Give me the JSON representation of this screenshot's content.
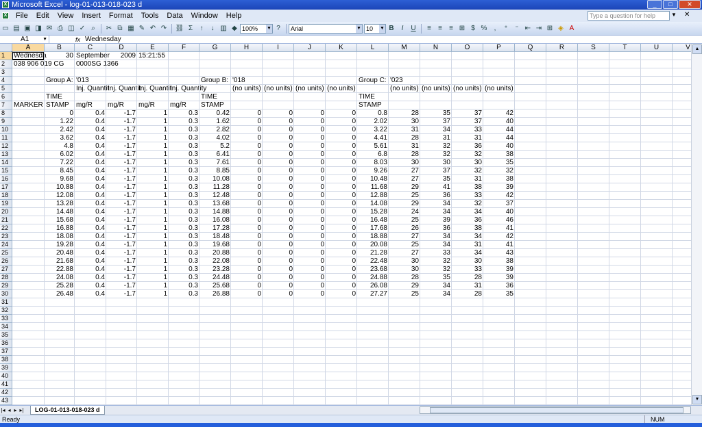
{
  "window": {
    "title": "Microsoft Excel - log-01-013-018-023 d"
  },
  "menu": [
    "File",
    "Edit",
    "View",
    "Insert",
    "Format",
    "Tools",
    "Data",
    "Window",
    "Help"
  ],
  "help_placeholder": "Type a question for help",
  "toolbar": {
    "zoom": "100%",
    "font": "Arial",
    "size": "10",
    "bold": "B",
    "italic": "I",
    "underline": "U",
    "currency": "%"
  },
  "formula": {
    "cell_ref": "A1",
    "fx": "fx",
    "content": "Wednesday"
  },
  "columns": [
    "A",
    "B",
    "C",
    "D",
    "E",
    "F",
    "G",
    "H",
    "I",
    "J",
    "K",
    "L",
    "M",
    "N",
    "O",
    "P",
    "Q",
    "R",
    "S",
    "T",
    "U",
    "V"
  ],
  "rows": [
    "1",
    "2",
    "3",
    "4",
    "5",
    "6",
    "7",
    "8",
    "9",
    "10",
    "11",
    "12",
    "13",
    "14",
    "15",
    "16",
    "17",
    "18",
    "19",
    "20",
    "21",
    "22",
    "23",
    "24",
    "25",
    "26",
    "27",
    "28",
    "29",
    "30",
    "31",
    "32",
    "33",
    "34",
    "35",
    "36",
    "37",
    "38",
    "39",
    "40",
    "41",
    "42",
    "43"
  ],
  "header_cells": {
    "a1": "Wednesda",
    "b1": "30",
    "c1": "September",
    "d1": "2009",
    "e1": "15:21:55",
    "a2": "038 906 019 CG",
    "c2": "0000SG  1366",
    "b4": "Group A:",
    "c4": "'013",
    "g4": "Group B:",
    "h4": "'018",
    "l4": "Group C:",
    "m4": "'023",
    "c5": "Inj. Quantit",
    "d5": "Inj. Quantit",
    "e5": "Inj. Quantit",
    "f5": "Inj. Quantity",
    "h5": "(no units)",
    "i5": "(no units)",
    "j5": "(no units)",
    "k5": "(no units)",
    "m5": "(no units)",
    "n5": "(no units)",
    "o5": "(no units)",
    "p5": "(no units)",
    "b6": "TIME",
    "g6": "TIME",
    "l6": "TIME",
    "a7": "MARKER",
    "b7": "STAMP",
    "c7": "mg/R",
    "d7": "mg/R",
    "e7": "mg/R",
    "f7": "mg/R",
    "g7": "STAMP",
    "l7": "STAMP"
  },
  "data_rows": [
    [
      "0",
      "0.4",
      "-1.7",
      "1",
      "0.3",
      "0.42",
      "0",
      "0",
      "0",
      "0",
      "0.8",
      "28",
      "35",
      "37",
      "42"
    ],
    [
      "1.22",
      "0.4",
      "-1.7",
      "1",
      "0.3",
      "1.62",
      "0",
      "0",
      "0",
      "0",
      "2.02",
      "30",
      "37",
      "37",
      "40"
    ],
    [
      "2.42",
      "0.4",
      "-1.7",
      "1",
      "0.3",
      "2.82",
      "0",
      "0",
      "0",
      "0",
      "3.22",
      "31",
      "34",
      "33",
      "44"
    ],
    [
      "3.62",
      "0.4",
      "-1.7",
      "1",
      "0.3",
      "4.02",
      "0",
      "0",
      "0",
      "0",
      "4.41",
      "28",
      "31",
      "31",
      "44"
    ],
    [
      "4.8",
      "0.4",
      "-1.7",
      "1",
      "0.3",
      "5.2",
      "0",
      "0",
      "0",
      "0",
      "5.61",
      "31",
      "32",
      "36",
      "40"
    ],
    [
      "6.02",
      "0.4",
      "-1.7",
      "1",
      "0.3",
      "6.41",
      "0",
      "0",
      "0",
      "0",
      "6.8",
      "28",
      "32",
      "32",
      "38"
    ],
    [
      "7.22",
      "0.4",
      "-1.7",
      "1",
      "0.3",
      "7.61",
      "0",
      "0",
      "0",
      "0",
      "8.03",
      "30",
      "30",
      "30",
      "35"
    ],
    [
      "8.45",
      "0.4",
      "-1.7",
      "1",
      "0.3",
      "8.85",
      "0",
      "0",
      "0",
      "0",
      "9.26",
      "27",
      "37",
      "32",
      "32"
    ],
    [
      "9.68",
      "0.4",
      "-1.7",
      "1",
      "0.3",
      "10.08",
      "0",
      "0",
      "0",
      "0",
      "10.48",
      "27",
      "35",
      "31",
      "38"
    ],
    [
      "10.88",
      "0.4",
      "-1.7",
      "1",
      "0.3",
      "11.28",
      "0",
      "0",
      "0",
      "0",
      "11.68",
      "29",
      "41",
      "38",
      "39"
    ],
    [
      "12.08",
      "0.4",
      "-1.7",
      "1",
      "0.3",
      "12.48",
      "0",
      "0",
      "0",
      "0",
      "12.88",
      "25",
      "36",
      "33",
      "42"
    ],
    [
      "13.28",
      "0.4",
      "-1.7",
      "1",
      "0.3",
      "13.68",
      "0",
      "0",
      "0",
      "0",
      "14.08",
      "29",
      "34",
      "32",
      "37"
    ],
    [
      "14.48",
      "0.4",
      "-1.7",
      "1",
      "0.3",
      "14.88",
      "0",
      "0",
      "0",
      "0",
      "15.28",
      "24",
      "34",
      "34",
      "40"
    ],
    [
      "15.68",
      "0.4",
      "-1.7",
      "1",
      "0.3",
      "16.08",
      "0",
      "0",
      "0",
      "0",
      "16.48",
      "25",
      "39",
      "36",
      "46"
    ],
    [
      "16.88",
      "0.4",
      "-1.7",
      "1",
      "0.3",
      "17.28",
      "0",
      "0",
      "0",
      "0",
      "17.68",
      "26",
      "36",
      "38",
      "41"
    ],
    [
      "18.08",
      "0.4",
      "-1.7",
      "1",
      "0.3",
      "18.48",
      "0",
      "0",
      "0",
      "0",
      "18.88",
      "27",
      "34",
      "34",
      "42"
    ],
    [
      "19.28",
      "0.4",
      "-1.7",
      "1",
      "0.3",
      "19.68",
      "0",
      "0",
      "0",
      "0",
      "20.08",
      "25",
      "34",
      "31",
      "41"
    ],
    [
      "20.48",
      "0.4",
      "-1.7",
      "1",
      "0.3",
      "20.88",
      "0",
      "0",
      "0",
      "0",
      "21.28",
      "27",
      "33",
      "34",
      "43"
    ],
    [
      "21.68",
      "0.4",
      "-1.7",
      "1",
      "0.3",
      "22.08",
      "0",
      "0",
      "0",
      "0",
      "22.48",
      "30",
      "32",
      "30",
      "38"
    ],
    [
      "22.88",
      "0.4",
      "-1.7",
      "1",
      "0.3",
      "23.28",
      "0",
      "0",
      "0",
      "0",
      "23.68",
      "30",
      "32",
      "33",
      "39"
    ],
    [
      "24.08",
      "0.4",
      "-1.7",
      "1",
      "0.3",
      "24.48",
      "0",
      "0",
      "0",
      "0",
      "24.88",
      "28",
      "35",
      "28",
      "39"
    ],
    [
      "25.28",
      "0.4",
      "-1.7",
      "1",
      "0.3",
      "25.68",
      "0",
      "0",
      "0",
      "0",
      "26.08",
      "29",
      "34",
      "31",
      "36"
    ],
    [
      "26.48",
      "0.4",
      "-1.7",
      "1",
      "0.3",
      "26.88",
      "0",
      "0",
      "0",
      "0",
      "27.27",
      "25",
      "34",
      "28",
      "35"
    ]
  ],
  "sheet_tab": "LOG-01-013-018-023 d",
  "status": {
    "ready": "Ready",
    "num": "NUM"
  }
}
